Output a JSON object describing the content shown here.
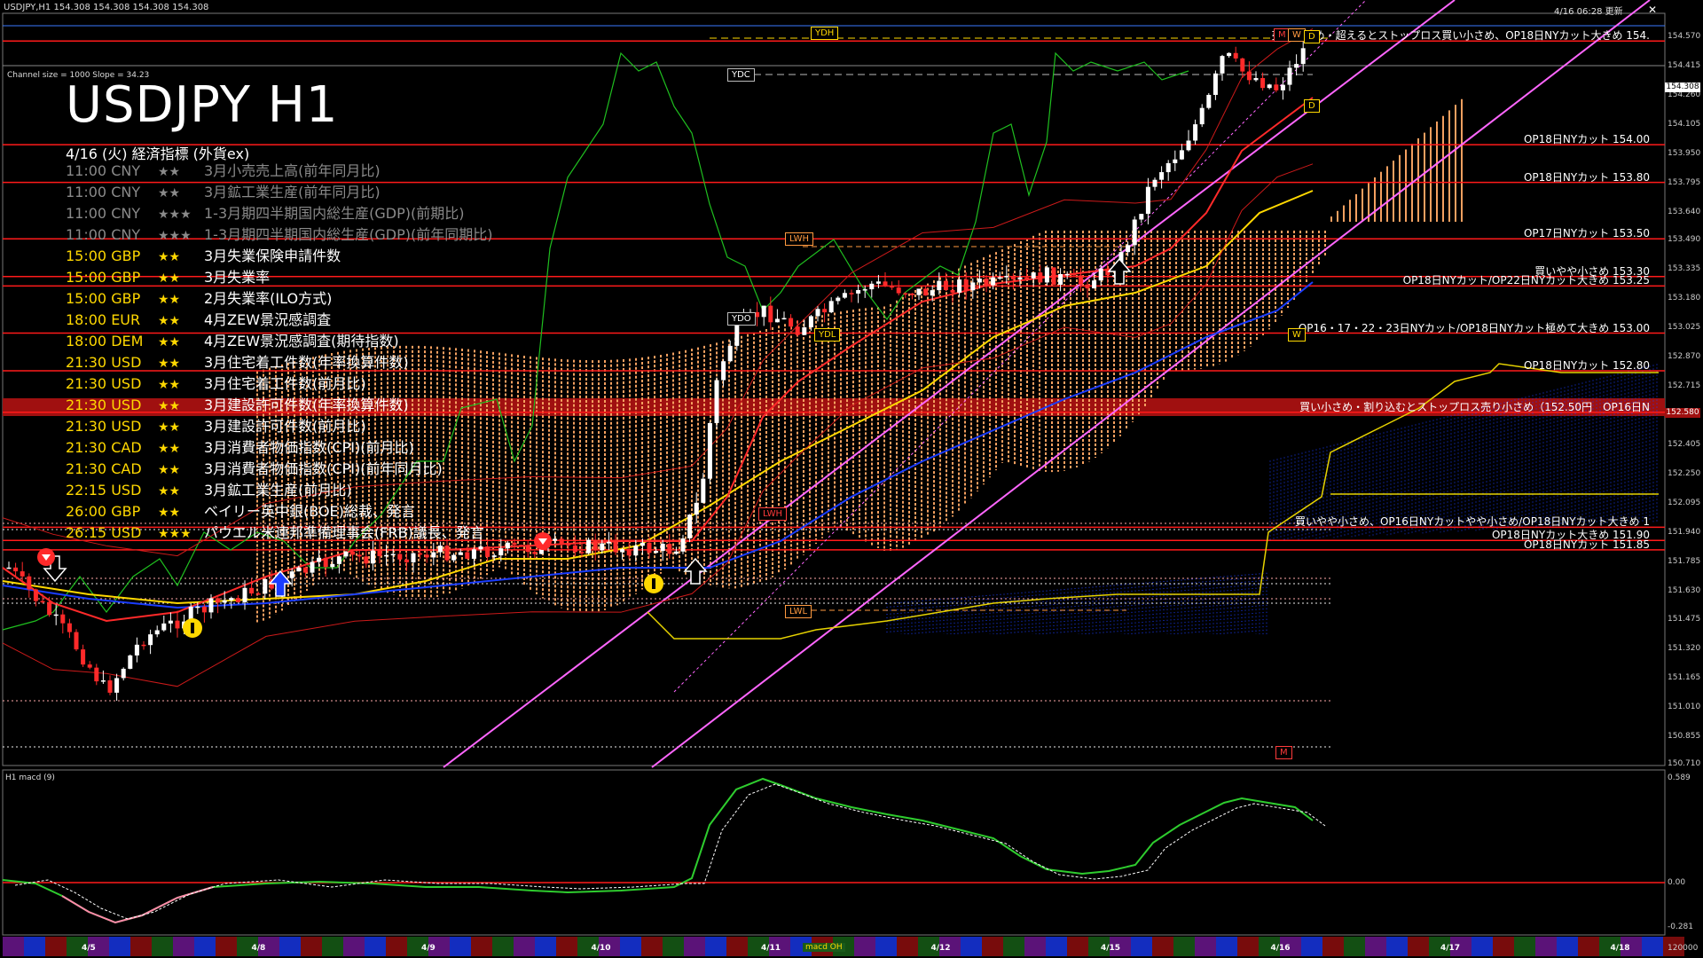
{
  "window": {
    "caption": "USDJPY,H1  154.308 154.308 154.308 154.308",
    "updated": "4/16 06:28 更新",
    "channel_info": "Channel size = 1000 Slope = 34.23",
    "symbol_title": "USDJPY H1"
  },
  "calendar": {
    "header": "4/16 (火) 経済指標 (外貨ex)",
    "events": [
      {
        "time": "11:00",
        "cur": "CNY",
        "stars": "★★",
        "name": "3月小売売上高(前年同月比)",
        "state": "past"
      },
      {
        "time": "11:00",
        "cur": "CNY",
        "stars": "★★",
        "name": "3月鉱工業生産(前年同月比)",
        "state": "past"
      },
      {
        "time": "11:00",
        "cur": "CNY",
        "stars": "★★★",
        "name": "1-3月期四半期国内総生産(GDP)(前期比)",
        "state": "past"
      },
      {
        "time": "11:00",
        "cur": "CNY",
        "stars": "★★★",
        "name": "1-3月期四半期国内総生産(GDP)(前年同期比)",
        "state": "past"
      },
      {
        "time": "15:00",
        "cur": "GBP",
        "stars": "★★",
        "name": "3月失業保険申請件数",
        "state": "normal"
      },
      {
        "time": "15:00",
        "cur": "GBP",
        "stars": "★★",
        "name": "3月失業率",
        "state": "normal"
      },
      {
        "time": "15:00",
        "cur": "GBP",
        "stars": "★★",
        "name": "2月失業率(ILO方式)",
        "state": "normal"
      },
      {
        "time": "18:00",
        "cur": "EUR",
        "stars": "★★",
        "name": "4月ZEW景況感調査",
        "state": "normal"
      },
      {
        "time": "18:00",
        "cur": "DEM",
        "stars": "★★",
        "name": "4月ZEW景況感調査(期待指数)",
        "state": "normal"
      },
      {
        "time": "21:30",
        "cur": "USD",
        "stars": "★★",
        "name": "3月住宅着工件数(年率換算件数)",
        "state": "normal"
      },
      {
        "time": "21:30",
        "cur": "USD",
        "stars": "★★",
        "name": "3月住宅着工件数(前月比)",
        "state": "normal"
      },
      {
        "time": "21:30",
        "cur": "USD",
        "stars": "★★",
        "name": "3月建設許可件数(年率換算件数)",
        "state": "highlight"
      },
      {
        "time": "21:30",
        "cur": "USD",
        "stars": "★★",
        "name": "3月建設許可件数(前月比)",
        "state": "normal"
      },
      {
        "time": "21:30",
        "cur": "CAD",
        "stars": "★★",
        "name": "3月消費者物価指数(CPI)(前月比)",
        "state": "normal"
      },
      {
        "time": "21:30",
        "cur": "CAD",
        "stars": "★★",
        "name": "3月消費者物価指数(CPI)(前年同月比)",
        "state": "normal"
      },
      {
        "time": "22:15",
        "cur": "USD",
        "stars": "★★",
        "name": "3月鉱工業生産(前月比)",
        "state": "normal"
      },
      {
        "time": "26:00",
        "cur": "GBP",
        "stars": "★★",
        "name": "ベイリー英中銀(BOE)総裁、発言",
        "state": "normal"
      },
      {
        "time": "26:15",
        "cur": "USD",
        "stars": "★★★",
        "name": "パウエル米連邦準備理事会(FRB)議長、発言",
        "state": "normal"
      }
    ]
  },
  "level_labels": [
    {
      "text": "売り小さめ・超えるとストップロス買い小さめ、OP18日NYカット大きめ 154.",
      "price": 154.55
    },
    {
      "text": "OP18日NYカット 154.00",
      "price": 154.0
    },
    {
      "text": "OP18日NYカット 153.80",
      "price": 153.8
    },
    {
      "text": "OP17日NYカット 153.50",
      "price": 153.5
    },
    {
      "text": "買いやや小さめ 153.30",
      "price": 153.3
    },
    {
      "text": "OP18日NYカット/OP22日NYカット大きめ 153.25",
      "price": 153.25
    },
    {
      "text": "OP16・17・22・23日NYカット/OP18日NYカット極めて大きめ 153.00",
      "price": 153.0
    },
    {
      "text": "OP18日NYカット 152.80",
      "price": 152.8
    },
    {
      "text": "買い小さめ・割り込むとストップロス売り小さめ（152.50円　OP16日N",
      "price": 152.58
    },
    {
      "text": "買いやや小さめ、OP16日NYカットやや小さめ/OP18日NYカット大きめ 1",
      "price": 151.97
    },
    {
      "text": "OP18日NYカット大きめ 151.90",
      "price": 151.9
    },
    {
      "text": "OP18日NYカット 151.85",
      "price": 151.85
    }
  ],
  "price_axis": {
    "ticks": [
      "154.570",
      "154.415",
      "154.260",
      "154.105",
      "153.950",
      "153.795",
      "153.640",
      "153.490",
      "153.335",
      "153.180",
      "153.025",
      "152.870",
      "152.715",
      "152.560",
      "152.405",
      "152.250",
      "152.095",
      "151.940",
      "151.785",
      "151.630",
      "151.475",
      "151.320",
      "151.165",
      "151.010",
      "150.855",
      "150.710"
    ],
    "current": "154.308",
    "bid_box": "152.580"
  },
  "macd": {
    "label": "H1  macd (9)",
    "ticks": [
      "0.589",
      "0.00",
      "-0.281"
    ],
    "volume_tick": "120000"
  },
  "date_axis": {
    "dates": [
      "4/5",
      "4/8",
      "4/9",
      "4/10",
      "4/11",
      "4/12",
      "4/15",
      "4/16",
      "4/17",
      "4/18"
    ],
    "button": "macd OH"
  },
  "tags": [
    {
      "text": "YDH",
      "kind": "y"
    },
    {
      "text": "YDC",
      "kind": "w"
    },
    {
      "text": "YDO",
      "kind": "w"
    },
    {
      "text": "YDL",
      "kind": "y"
    },
    {
      "text": "LWH",
      "kind": "o"
    },
    {
      "text": "LWH",
      "kind": "r"
    },
    {
      "text": "LWL",
      "kind": "o"
    },
    {
      "text": "M",
      "kind": "r"
    },
    {
      "text": "W",
      "kind": "o"
    },
    {
      "text": "D",
      "kind": "y"
    },
    {
      "text": "D",
      "kind": "y"
    },
    {
      "text": "M",
      "kind": "r"
    },
    {
      "text": "W",
      "kind": "y"
    }
  ],
  "colors": {
    "level_line": "#ff1a1a",
    "highlight_band": "#a01010",
    "channel": "#ff66ff",
    "ma_yellow": "#ffd800",
    "ma_blue": "#1a3cff",
    "cloud_orange": "#f4a060",
    "cloud_blue": "#1a3cff",
    "stoch_green": "#1fbf1f",
    "bull_candle": "#ffffff",
    "bear_candle": "#ff2a2a"
  }
}
